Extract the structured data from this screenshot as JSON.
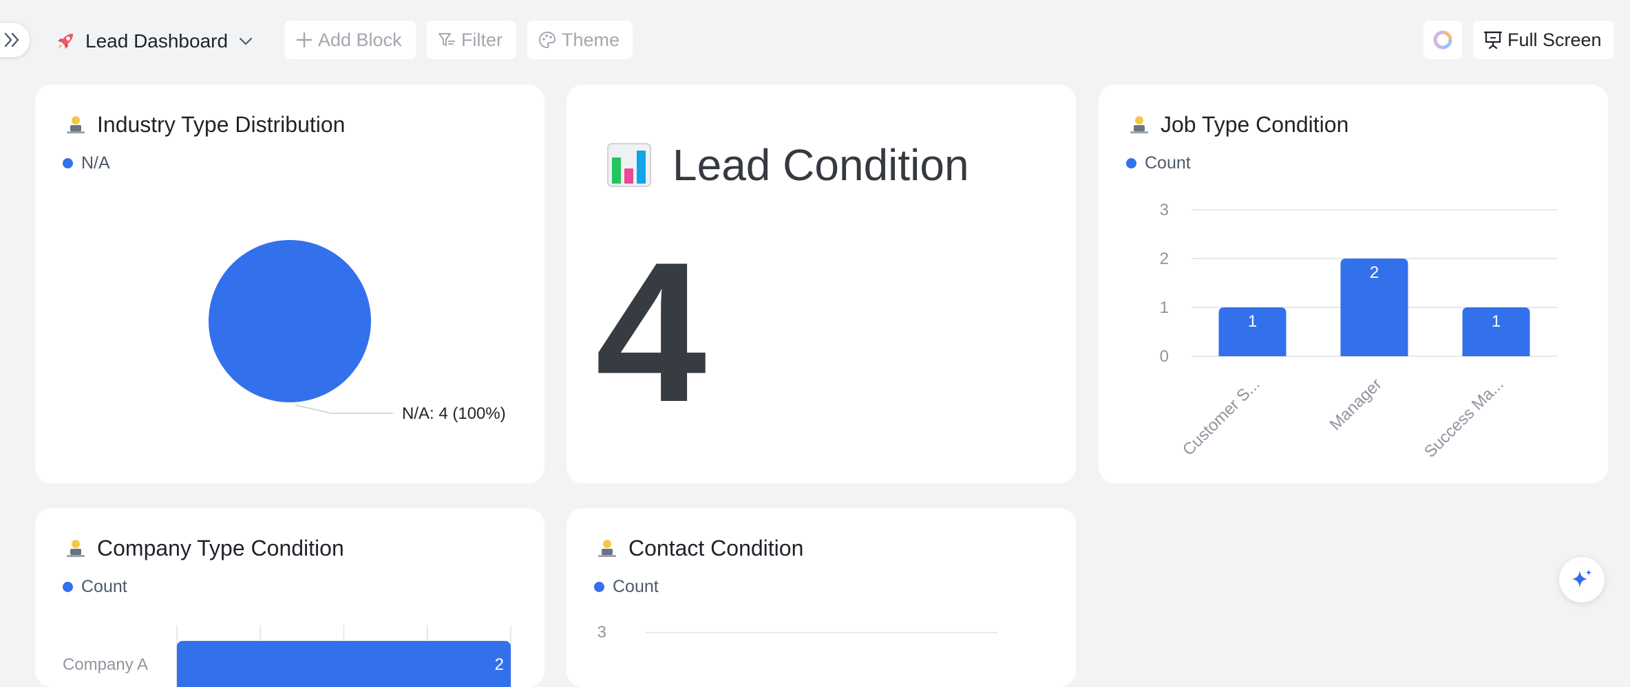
{
  "toolbar": {
    "dashboard_title": "Lead Dashboard",
    "add_block": "Add Block",
    "filter": "Filter",
    "theme": "Theme",
    "full_screen": "Full Screen"
  },
  "colors": {
    "accent": "#3370eb",
    "text": "#1f2329",
    "muted": "#8f959e"
  },
  "cards": {
    "industry": {
      "title": "Industry Type Distribution",
      "legend": "N/A",
      "slice_label": "N/A: 4 (100%)"
    },
    "lead": {
      "title": "Lead Condition",
      "value": "4"
    },
    "job": {
      "title": "Job Type Condition",
      "legend": "Count"
    },
    "company": {
      "title": "Company Type Condition",
      "legend": "Count",
      "category": "Company A",
      "value_label": "2"
    },
    "contact": {
      "title": "Contact Condition",
      "legend": "Count",
      "tick": "3"
    }
  },
  "chart_data": [
    {
      "type": "pie",
      "categories": [
        "N/A"
      ],
      "values": [
        4
      ],
      "labels": [
        "N/A: 4 (100%)"
      ]
    },
    {
      "type": "bar",
      "categories": [
        "Customer S...",
        "Manager",
        "Success Ma..."
      ],
      "series": [
        {
          "name": "Count",
          "values": [
            1,
            2,
            1
          ]
        }
      ],
      "y_ticks": [
        "0",
        "1",
        "2",
        "3"
      ],
      "ylim": [
        0,
        3
      ],
      "grid": true,
      "legend": "top-left"
    },
    {
      "type": "bar",
      "orientation": "horizontal",
      "categories": [
        "Company A"
      ],
      "series": [
        {
          "name": "Count",
          "values": [
            2
          ]
        }
      ],
      "grid": true,
      "legend": "top-left"
    },
    {
      "type": "bar",
      "series": [
        {
          "name": "Count",
          "values": []
        }
      ],
      "y_ticks": [
        "3"
      ],
      "grid": true,
      "legend": "top-left"
    }
  ]
}
